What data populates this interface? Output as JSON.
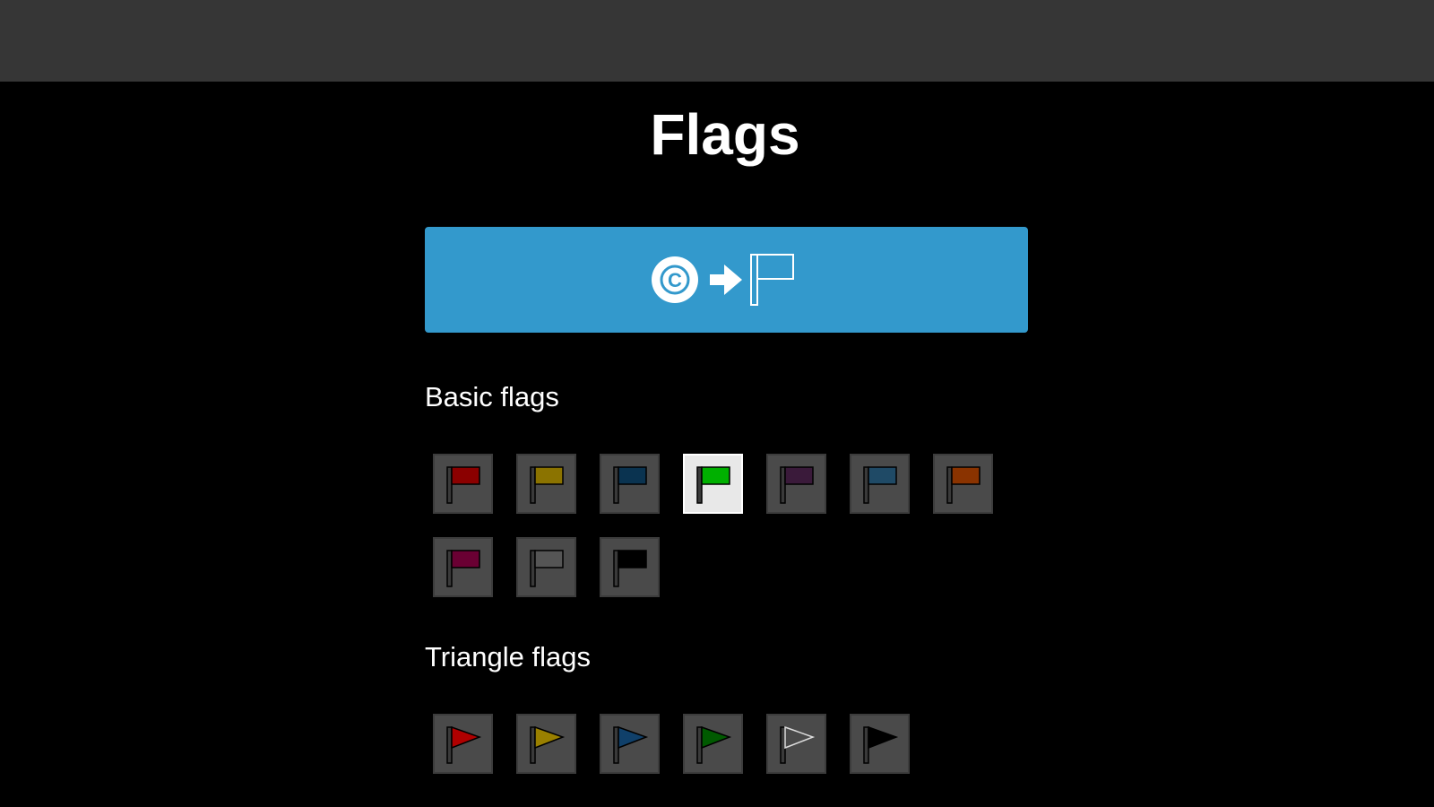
{
  "page": {
    "title": "Flags"
  },
  "colors": {
    "topbar": "#363636",
    "background": "#000000",
    "convert_button": "#3399cc",
    "tile": "#4a4a4a",
    "tile_selected": "#e8e8e8"
  },
  "convert_button": {
    "icons": [
      "copyright-circle-icon",
      "arrow-right-icon",
      "flag-outline-icon"
    ],
    "icon_letter": "C"
  },
  "basic_flags": {
    "heading": "Basic flags",
    "items": [
      {
        "name": "red",
        "color": "#8b0000",
        "selected": false
      },
      {
        "name": "yellow",
        "color": "#8b7300",
        "selected": false
      },
      {
        "name": "navy",
        "color": "#0a3350",
        "selected": false
      },
      {
        "name": "green",
        "color": "#00b000",
        "selected": true
      },
      {
        "name": "purple",
        "color": "#3a1a3a",
        "selected": false
      },
      {
        "name": "teal",
        "color": "#1f4a66",
        "selected": false
      },
      {
        "name": "orange",
        "color": "#8a3300",
        "selected": false
      },
      {
        "name": "magenta",
        "color": "#6a0033",
        "selected": false
      },
      {
        "name": "gray",
        "color": "#555555",
        "selected": false
      },
      {
        "name": "black",
        "color": "#000000",
        "selected": false
      }
    ]
  },
  "triangle_flags": {
    "heading": "Triangle flags",
    "items": [
      {
        "name": "red",
        "color": "#b00000",
        "selected": false
      },
      {
        "name": "yellow",
        "color": "#9a8000",
        "selected": false
      },
      {
        "name": "navy",
        "color": "#10406a",
        "selected": false
      },
      {
        "name": "green",
        "color": "#005a00",
        "selected": false
      },
      {
        "name": "white",
        "color": "#4a4a4a",
        "selected": false
      },
      {
        "name": "black",
        "color": "#000000",
        "selected": false
      }
    ]
  }
}
